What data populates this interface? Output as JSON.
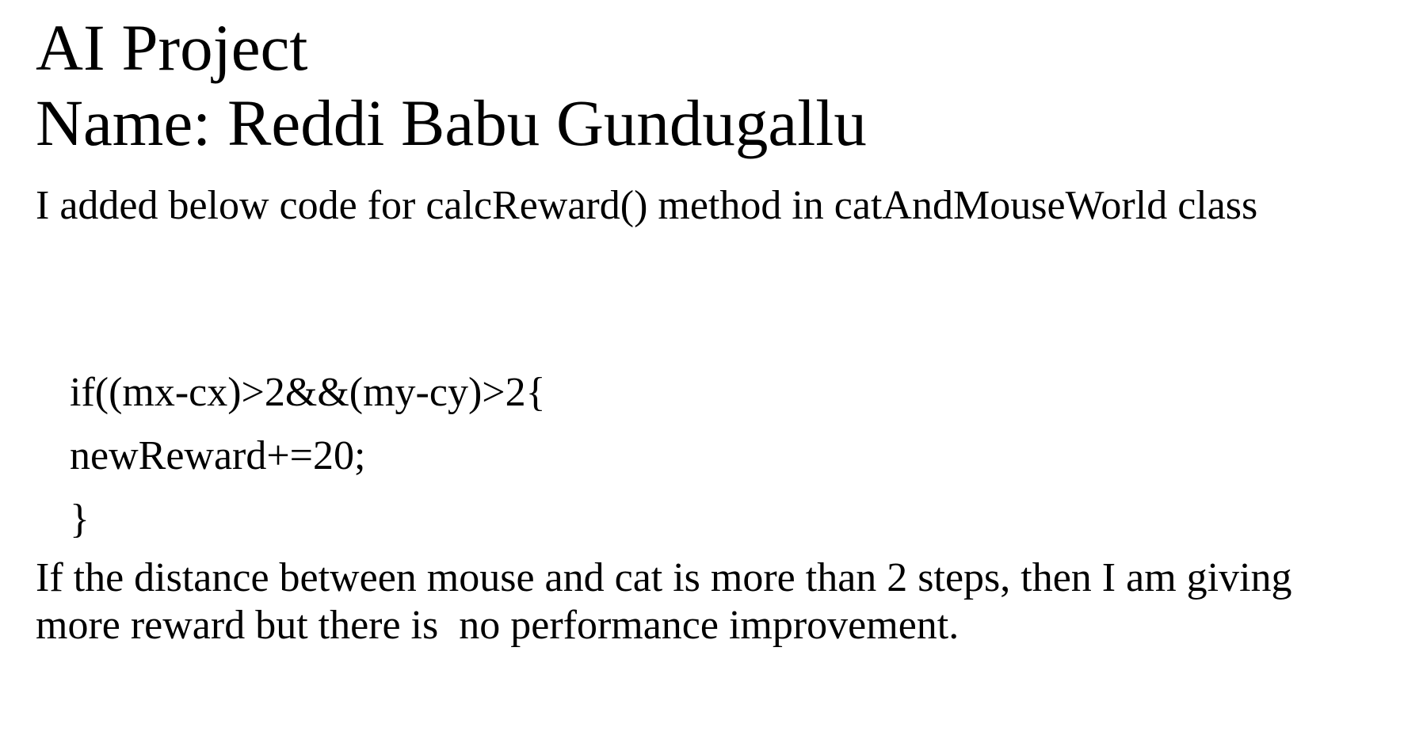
{
  "document": {
    "title": "AI Project",
    "author_line": "Name: Reddi Babu Gundugallu",
    "intro": "I added below code for calcReward() method in catAndMouseWorld class",
    "code_lines": [
      "if((mx-cx)>2&&(my-cy)>2{",
      "newReward+=20;",
      "}"
    ],
    "outro": "If the distance between mouse and cat is more than 2 steps, then I am giving more reward but there is  no performance improvement."
  }
}
